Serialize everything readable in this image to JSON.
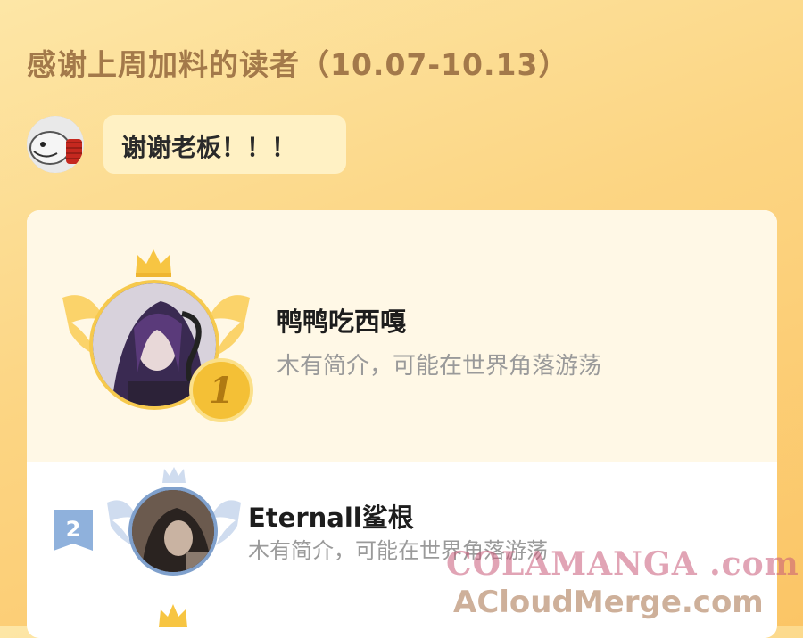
{
  "header": {
    "title": "感谢上周加料的读者（10.07-10.13）"
  },
  "thanks": {
    "message": "谢谢老板！！！"
  },
  "leaderboard": {
    "entries": [
      {
        "rank": "1",
        "name": "鸭鸭吃西嘎",
        "bio": "木有简介，可能在世界角落游荡",
        "ring_color": "#f6c94d"
      },
      {
        "rank": "2",
        "name": "Eternall鲨根",
        "bio": "木有简介，可能在世界角落游荡",
        "ring_color": "#7fa0cc"
      }
    ]
  },
  "watermark": {
    "line1": "COLAMANGA .com",
    "line2": "ACloudMerge.com"
  },
  "colors": {
    "gold": "#f6c94d",
    "silver_blue": "#7fa0cc",
    "title": "#a3794a"
  }
}
